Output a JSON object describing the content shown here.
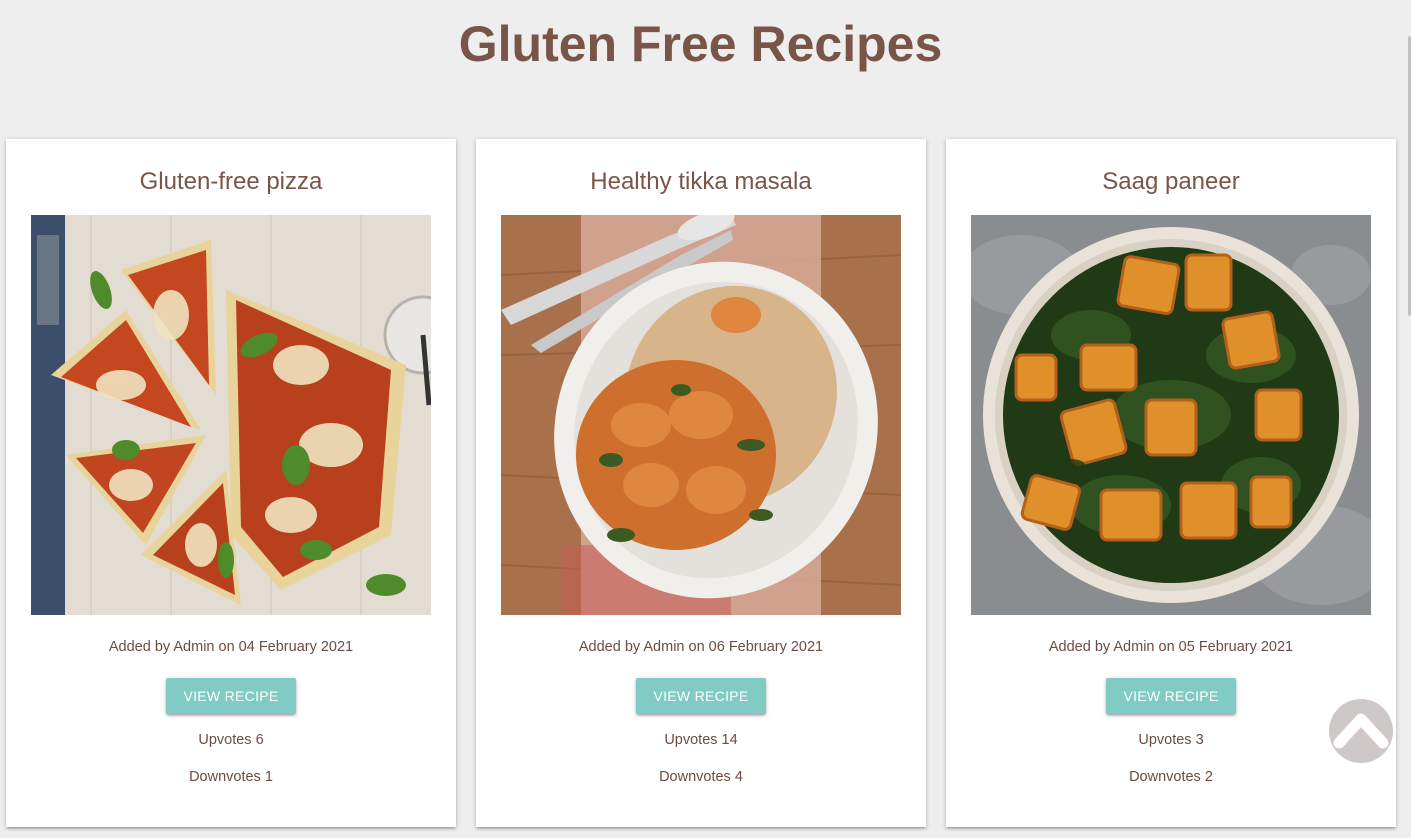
{
  "header": {
    "title": "Gluten Free Recipes"
  },
  "recipes": [
    {
      "title": "Gluten-free pizza",
      "image_icon": "pizza-photo",
      "meta": "Added by Admin on 04 February 2021",
      "button_label": "VIEW RECIPE",
      "upvotes": "Upvotes 6",
      "downvotes": "Downvotes 1"
    },
    {
      "title": "Healthy tikka masala",
      "image_icon": "tikka-masala-photo",
      "meta": "Added by Admin on 06 February 2021",
      "button_label": "VIEW RECIPE",
      "upvotes": "Upvotes 14",
      "downvotes": "Downvotes 4"
    },
    {
      "title": "Saag paneer",
      "image_icon": "saag-paneer-photo",
      "meta": "Added by Admin on 05 February 2021",
      "button_label": "VIEW RECIPE",
      "upvotes": "Upvotes 3",
      "downvotes": "Downvotes 2"
    }
  ],
  "back_to_top": {
    "icon": "chevron-up-icon"
  },
  "colors": {
    "title": "#795548",
    "button": "#80cbc4",
    "background": "#eeeeee"
  }
}
